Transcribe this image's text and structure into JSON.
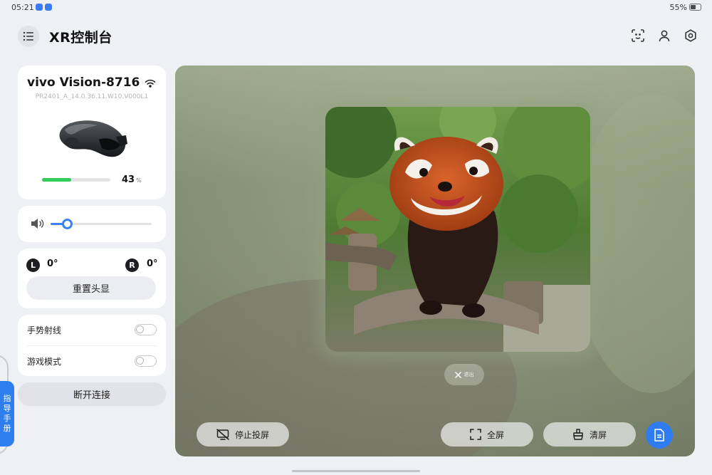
{
  "status_bar": {
    "time": "05:21",
    "battery_text": "55%",
    "battery_level": 0.55
  },
  "header": {
    "title": "XR控制台",
    "icons": [
      "menu-list-icon",
      "face-scan-icon",
      "person-icon",
      "settings-hex-icon"
    ]
  },
  "device": {
    "name": "vivo Vision-8716",
    "firmware": "PR2401_A_14.0.36.11.W10.V000L1",
    "battery_percent": "43",
    "battery_unit": "%",
    "battery_level": 0.43,
    "icons": [
      "wifi-icon",
      "headset-image"
    ]
  },
  "volume": {
    "level": 0.16,
    "icon": "speaker-icon"
  },
  "calibration": {
    "left_label": "L",
    "left_value": "0°",
    "right_label": "R",
    "right_value": "0°",
    "reset_label": "重置头显"
  },
  "toggles": [
    {
      "label": "手势射线",
      "on": false
    },
    {
      "label": "游戏模式",
      "on": false
    }
  ],
  "disconnect_label": "断开连接",
  "guide_tab": {
    "chars": [
      "指",
      "导",
      "手",
      "册"
    ]
  },
  "preview": {
    "exit_label": "退出",
    "stop_cast_label": "停止投屏",
    "fullscreen_label": "全屏",
    "clear_label": "清屏",
    "colors": {
      "accent": "#2e7cf0",
      "battery_green": "#32cc5d"
    }
  }
}
